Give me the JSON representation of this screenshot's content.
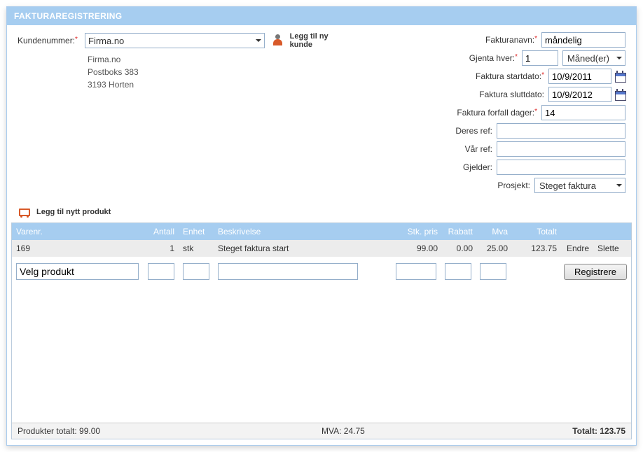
{
  "header": {
    "title": "FAKTURAREGISTRERING"
  },
  "customer": {
    "label": "Kundenummer:",
    "selected": "Firma.no",
    "address_name": "Firma.no",
    "address_line1": "Postboks 383",
    "address_line2": "3193 Horten"
  },
  "add_customer": {
    "label": "Legg til ny kunde"
  },
  "right": {
    "fakturanavn_label": "Fakturanavn:",
    "fakturanavn_value": "måndelig",
    "gjenta_label": "Gjenta hver:",
    "gjenta_value": "1",
    "gjenta_unit": "Måned(er)",
    "startdato_label": "Faktura startdato:",
    "startdato_value": "10/9/2011",
    "sluttdato_label": "Faktura sluttdato:",
    "sluttdato_value": "10/9/2012",
    "forfall_label": "Faktura forfall dager:",
    "forfall_value": "14",
    "deresref_label": "Deres ref:",
    "deresref_value": "",
    "varref_label": "Vår ref:",
    "varref_value": "",
    "gjelder_label": "Gjelder:",
    "gjelder_value": "",
    "prosjekt_label": "Prosjekt:",
    "prosjekt_selected": "Steget faktura"
  },
  "add_product": {
    "label": "Legg til nytt produkt"
  },
  "grid": {
    "headers": {
      "varenr": "Varenr.",
      "antall": "Antall",
      "enhet": "Enhet",
      "beskrivelse": "Beskrivelse",
      "stk_pris": "Stk. pris",
      "rabatt": "Rabatt",
      "mva": "Mva",
      "totalt": "Totalt"
    },
    "rows": [
      {
        "varenr": "169",
        "antall": "1",
        "enhet": "stk",
        "beskrivelse": "Steget faktura start",
        "stk_pris": "99.00",
        "rabatt": "0.00",
        "mva": "25.00",
        "totalt": "123.75",
        "edit_label": "Endre",
        "del_label": "Slette"
      }
    ],
    "new_row": {
      "product_value": "Velg produkt",
      "register_label": "Registrere"
    },
    "footer": {
      "produkter_totalt": "Produkter totalt: 99.00",
      "mva": "MVA: 24.75",
      "totalt": "Totalt: 123.75"
    }
  }
}
